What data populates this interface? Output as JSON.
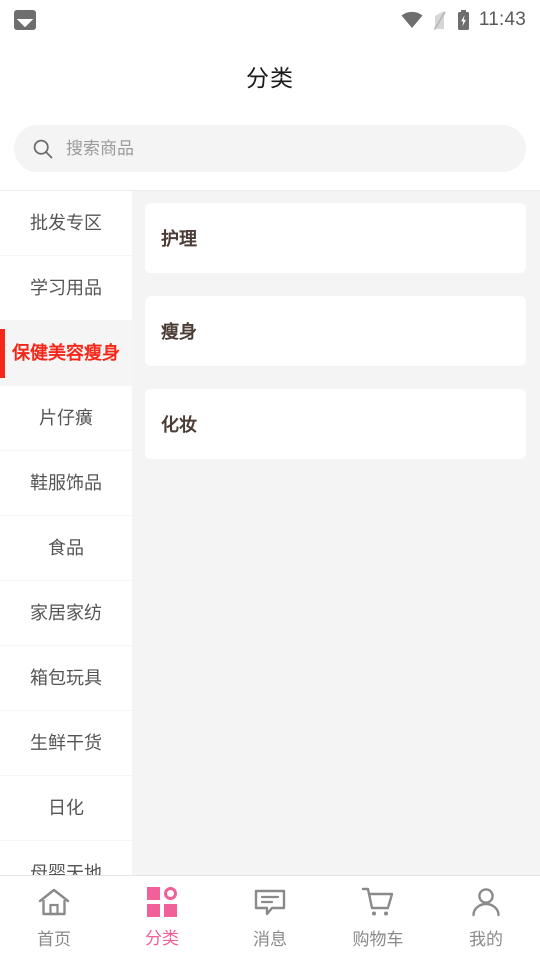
{
  "statusbar": {
    "notification_icon": "photo-icon",
    "wifi_icon": "wifi-icon",
    "signal_off_icon": "signal-off-icon",
    "battery_icon": "battery-charging-icon",
    "time": "11:43"
  },
  "header": {
    "title": "分类"
  },
  "search": {
    "icon": "search-icon",
    "placeholder": "搜索商品",
    "value": ""
  },
  "sidebar": {
    "active_index": 2,
    "items": [
      {
        "label": "批发专区"
      },
      {
        "label": "学习用品"
      },
      {
        "label": "保健美容瘦身"
      },
      {
        "label": "片仔癀"
      },
      {
        "label": "鞋服饰品"
      },
      {
        "label": "食品"
      },
      {
        "label": "家居家纺"
      },
      {
        "label": "箱包玩具"
      },
      {
        "label": "生鲜干货"
      },
      {
        "label": "日化"
      },
      {
        "label": "母婴天地"
      }
    ]
  },
  "content": {
    "cards": [
      {
        "label": "护理"
      },
      {
        "label": "瘦身"
      },
      {
        "label": "化妆"
      }
    ]
  },
  "bottomnav": {
    "active_index": 1,
    "items": [
      {
        "label": "首页",
        "icon": "home-icon"
      },
      {
        "label": "分类",
        "icon": "grid-icon"
      },
      {
        "label": "消息",
        "icon": "message-icon"
      },
      {
        "label": "购物车",
        "icon": "cart-icon"
      },
      {
        "label": "我的",
        "icon": "person-icon"
      }
    ]
  },
  "colors": {
    "accent_pink": "#f2609a",
    "active_red": "#f4281a",
    "page_bg": "#f4f4f4",
    "card_text": "#4b3d36"
  }
}
